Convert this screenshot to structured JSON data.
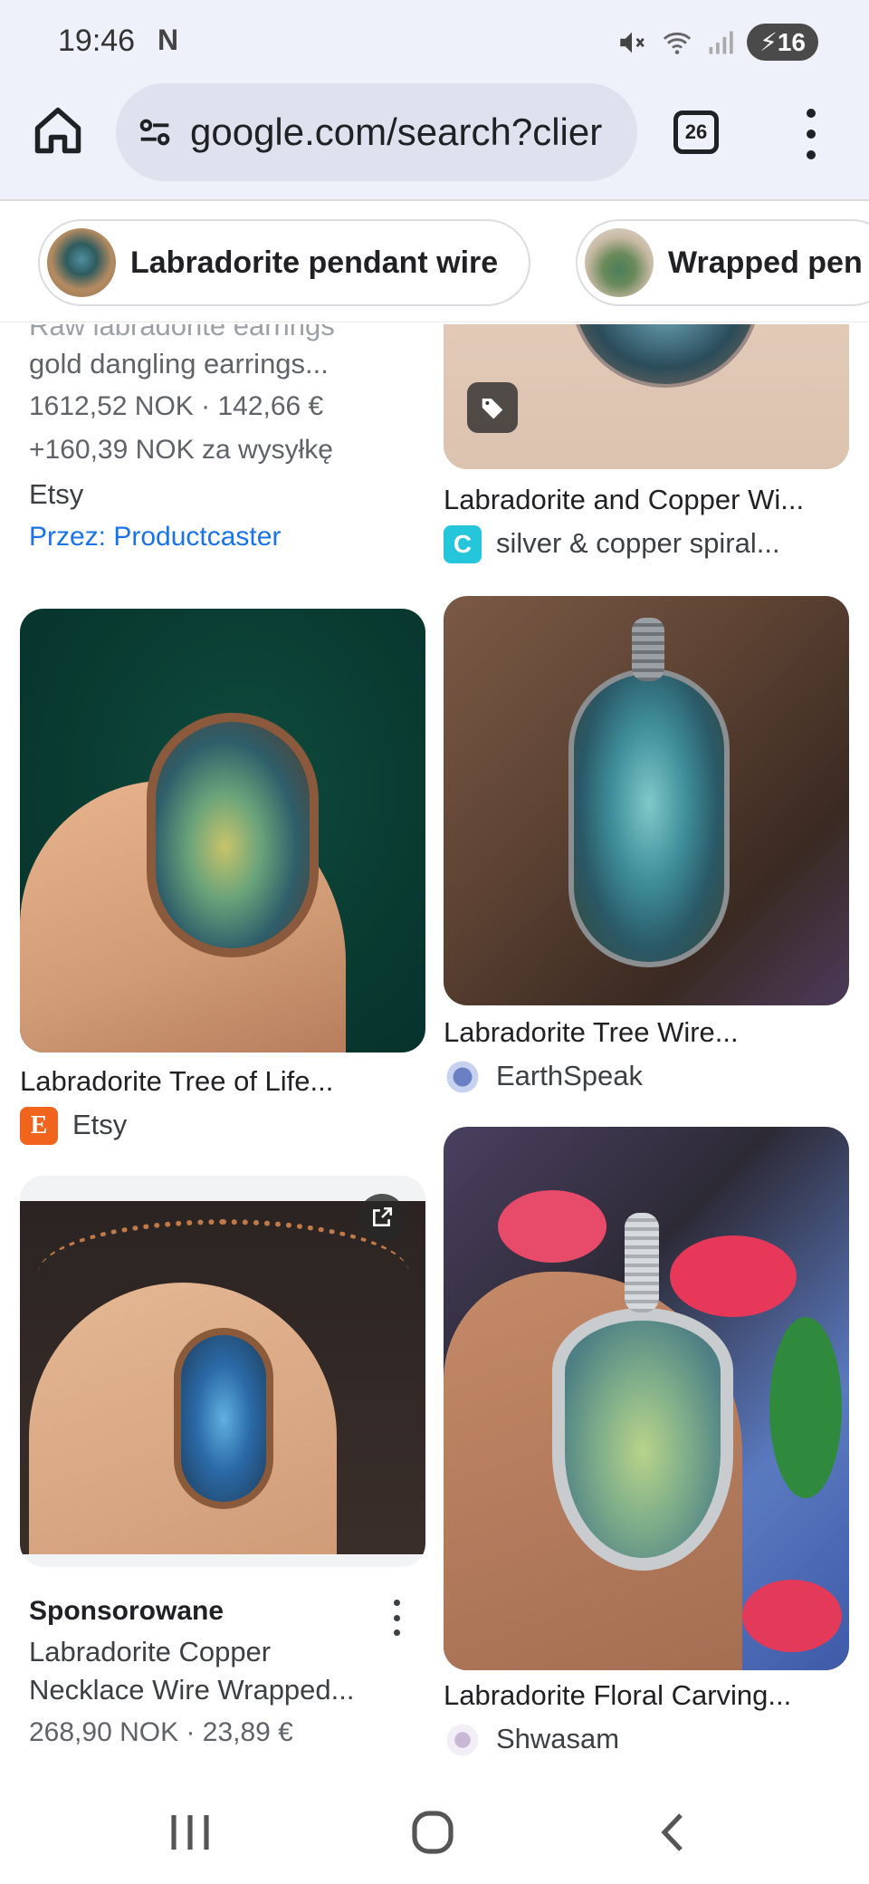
{
  "status": {
    "time": "19:46",
    "carrier_icon": "N",
    "battery": "16",
    "icons": [
      "mute-icon",
      "wifi-icon",
      "signal-icon",
      "battery-icon"
    ]
  },
  "browser": {
    "url": "google.com/search?clier",
    "tab_count": "26"
  },
  "chips": [
    {
      "label": "Labradorite pendant wire"
    },
    {
      "label": "Wrapped pen"
    }
  ],
  "results": {
    "r1": {
      "title_partial": "Raw labradorite earrings",
      "title": "gold dangling earrings...",
      "price": "1612,52 NOK · 142,66 €",
      "shipping": "+160,39 NOK za wysyłkę",
      "store": "Etsy",
      "via": "Przez: Productcaster"
    },
    "r2": {
      "title": "Labradorite and Copper Wi...",
      "source": "silver & copper spiral...",
      "favicon": "C"
    },
    "r3": {
      "title": "Labradorite Tree of Life...",
      "source": "Etsy",
      "favicon": "E"
    },
    "r4": {
      "title": "Labradorite Tree Wire...",
      "source": "EarthSpeak"
    },
    "r5": {
      "sponsored": "Sponsorowane",
      "title_line1": "Labradorite Copper",
      "title_line2": "Necklace Wire Wrapped...",
      "price": "268,90 NOK · 23,89 €"
    },
    "r6": {
      "title": "Labradorite Floral Carving...",
      "source": "Shwasam"
    }
  },
  "colors": {
    "bar_bg": "#eef0fa",
    "link": "#1a73e8",
    "etsy": "#f1641e",
    "c_favicon": "#26c6da"
  }
}
